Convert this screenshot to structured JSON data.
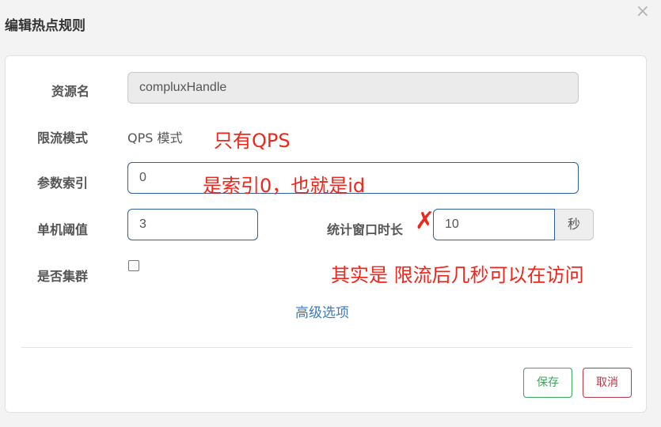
{
  "dialog": {
    "title": "编辑热点规则",
    "close_glyph": "×"
  },
  "form": {
    "resource_label": "资源名",
    "resource_value": "compluxHandle",
    "limit_mode_label": "限流模式",
    "limit_mode_value": "QPS 模式",
    "param_index_label": "参数索引",
    "param_index_value": "0",
    "threshold_label": "单机阈值",
    "threshold_value": "3",
    "window_label": "统计窗口时长",
    "window_value": "10",
    "window_unit": "秒",
    "cluster_label": "是否集群",
    "cluster_checked": false,
    "advanced_link": "高级选项"
  },
  "actions": {
    "save_label": "保存",
    "cancel_label": "取消"
  },
  "annotations": {
    "qps_note": "只有QPS",
    "index_note": "是索引0，也就是id",
    "cross_mark": "✗",
    "window_note": "其实是 限流后几秒可以在访问"
  },
  "colors": {
    "annotation": "#f0261b",
    "save": "#3aa65a",
    "cancel": "#b8384a",
    "link": "#3a7bbd",
    "input_border": "#2f5f9e"
  }
}
